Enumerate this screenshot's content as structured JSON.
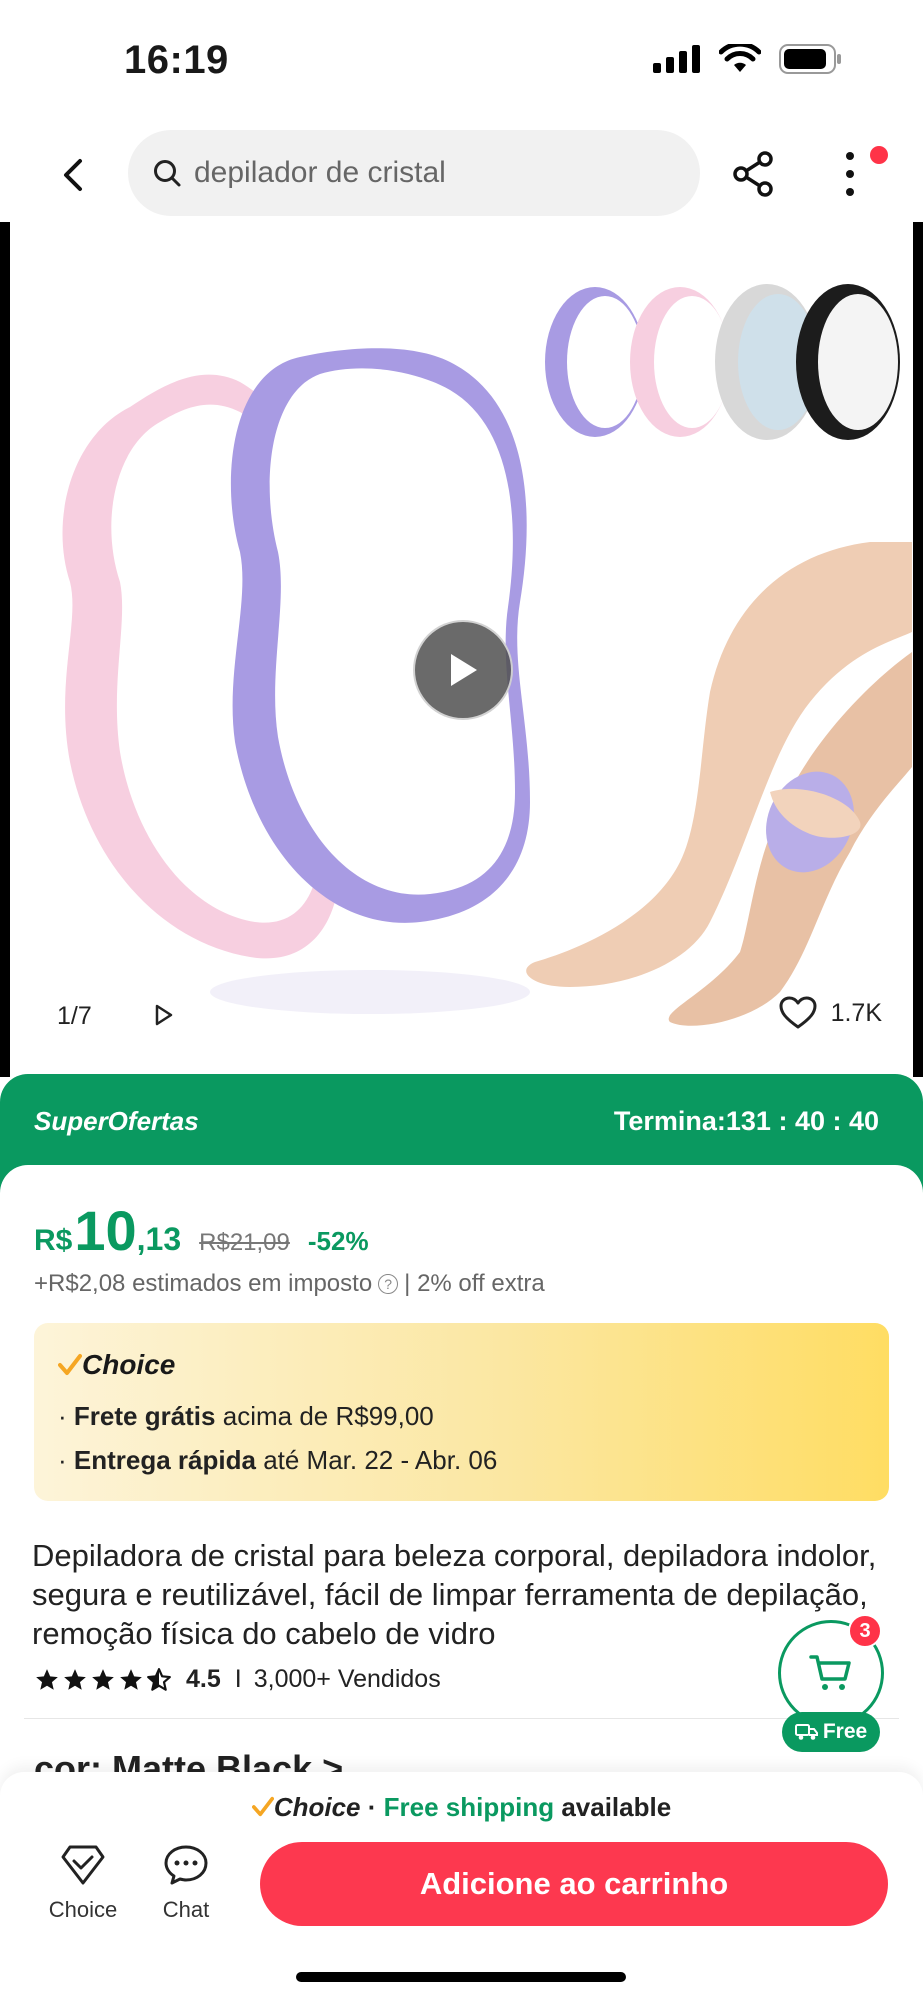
{
  "status_bar": {
    "time": "16:19"
  },
  "search": {
    "query": "depilador de cristal"
  },
  "gallery": {
    "counter": "1/7",
    "likes": "1.7K"
  },
  "offer": {
    "label": "SuperOfertas",
    "timer": "Termina:131 : 40 : 40"
  },
  "price": {
    "currency": "R$",
    "integer": "10",
    "decimal": ",13",
    "original": "R$21,09",
    "discount": "-52%",
    "tax_prefix": "+R$2,08 estimados em imposto",
    "tax_suffix": "| 2% off extra"
  },
  "choice_box": {
    "title": "Choice",
    "line1_bold": "Frete grátis",
    "line1_rest": "acima de R$99,00",
    "line2_bold": "Entrega rápida",
    "line2_rest": "até Mar. 22 - Abr. 06"
  },
  "product": {
    "title": "Depiladora de cristal para beleza corporal, depiladora indolor, segura e reutilizável, fácil de limpar ferramenta de depilação, remoção física do cabelo de vidro",
    "rating": "4.5",
    "rating_stars": 4.5,
    "sold": "3,000+ Vendidos",
    "color_row": "cor: Matte Black  >"
  },
  "floating_cart": {
    "badge": "3",
    "free": "Free"
  },
  "bottom": {
    "ship_choice": "Choice",
    "ship_sep": " · ",
    "ship_green": "Free shipping",
    "ship_rest": " available",
    "tab_choice": "Choice",
    "tab_chat": "Chat",
    "add_to_cart": "Adicione ao carrinho"
  },
  "colors": {
    "brand_green": "#0a9960",
    "cta_red": "#fd384f",
    "accent_orange": "#f5a623"
  }
}
